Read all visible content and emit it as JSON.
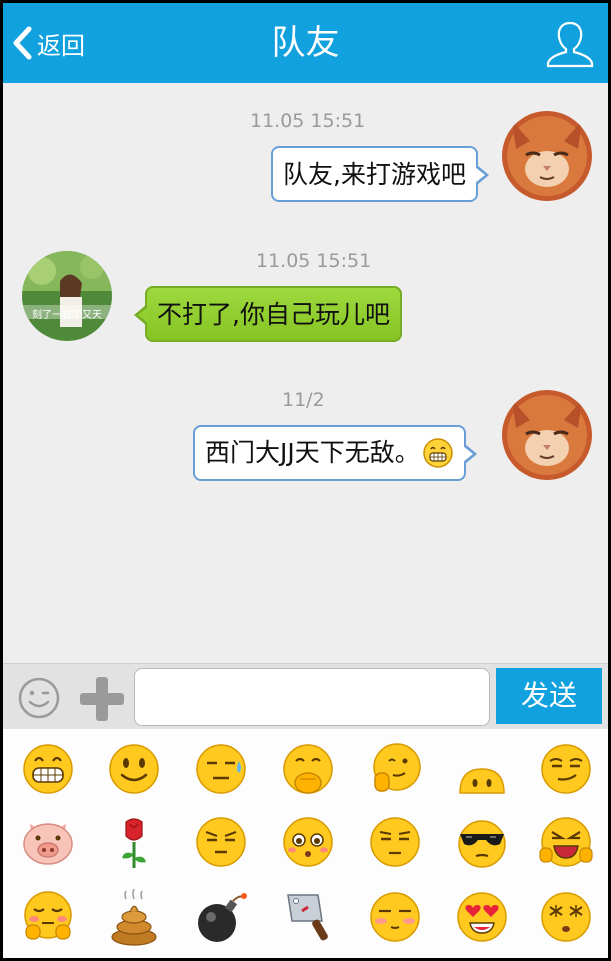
{
  "header": {
    "back_label": "返回",
    "title": "队友",
    "background": "#12a1df"
  },
  "messages": [
    {
      "timestamp": "11.05  15:51",
      "text": "队友,来打游戏吧",
      "sender": "me",
      "avatar": "orange-cat-avatar"
    },
    {
      "timestamp": "11.05  15:51",
      "text": "不打了,你自己玩儿吧",
      "sender": "friend",
      "avatar": "girl-photo-avatar",
      "avatar_caption": "刻了一桩了又天"
    },
    {
      "timestamp": "11/2",
      "text": "西门大JJ天下无敌。",
      "emoji": "grin-emoji",
      "sender": "me",
      "avatar": "orange-cat-avatar"
    }
  ],
  "input": {
    "value": "",
    "placeholder": "",
    "send_label": "发送"
  },
  "emoji_panel": {
    "rows": [
      [
        "grin",
        "smile",
        "sweat",
        "thinking",
        "ponder",
        "peek",
        "smirk"
      ],
      [
        "pig",
        "rose",
        "annoyed",
        "pitiful",
        "squint",
        "cool",
        "laugh-tears"
      ],
      [
        "shy",
        "poop",
        "bomb",
        "cleaver",
        "blush",
        "heart-eyes",
        "dizzy"
      ]
    ]
  },
  "colors": {
    "accent": "#12a1df",
    "my_bubble_border": "#6a9ed6",
    "friend_bubble": "#8ecd2c",
    "chat_bg": "#eeeeee"
  }
}
